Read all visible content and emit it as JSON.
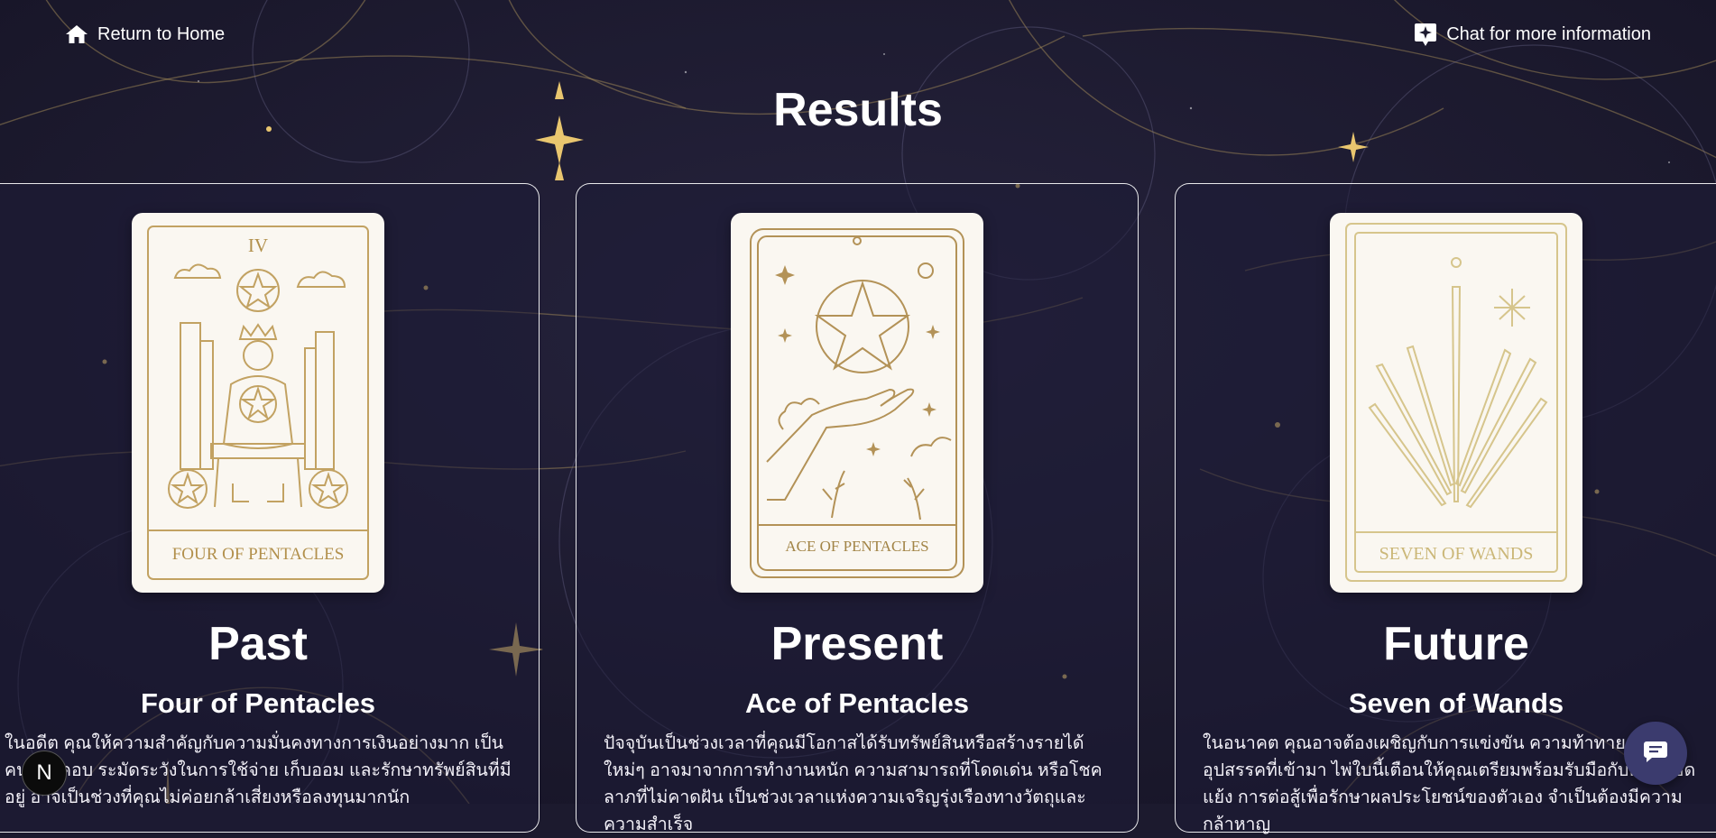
{
  "nav": {
    "home_label": "Return to Home",
    "chat_label": "Chat for more information"
  },
  "page": {
    "title": "Results"
  },
  "colors": {
    "background": "#1c1a2e",
    "gold": "#c9a95a",
    "card_face": "#faf7f1"
  },
  "cards": [
    {
      "slot": "Past",
      "name": "Four of Pentacles",
      "numeral": "IV",
      "face_title": "FOUR OF PENTACLES",
      "reading": "ในอดีต คุณให้ความสำคัญกับความมั่นคงทางการเงินอย่างมาก เป็นคนรอบคอบ ระมัดระวังในการใช้จ่าย เก็บออม และรักษาทรัพย์สินที่มีอยู่ อาจเป็นช่วงที่คุณไม่ค่อยกล้าเสี่ยงหรือลงทุนมากนัก"
    },
    {
      "slot": "Present",
      "name": "Ace of Pentacles",
      "face_title": "ACE OF PENTACLES",
      "reading": "ปัจจุบันเป็นช่วงเวลาที่คุณมีโอกาสได้รับทรัพย์สินหรือสร้างรายได้ใหม่ๆ อาจมาจากการทำงานหนัก ความสามารถที่โดดเด่น หรือโชคลาภที่ไม่คาดฝัน เป็นช่วงเวลาแห่งความเจริญรุ่งเรืองทางวัตถุและความสำเร็จ"
    },
    {
      "slot": "Future",
      "name": "Seven of Wands",
      "face_title": "SEVEN OF WANDS",
      "reading": "ในอนาคต คุณอาจต้องเผชิญกับการแข่งขัน ความท้าทาย หรืออุปสรรคที่เข้ามา ไพ่ใบนี้เตือนให้คุณเตรียมพร้อมรับมือกับความขัดแย้ง การต่อสู้เพื่อรักษาผลประโยชน์ของตัวเอง จำเป็นต้องมีความกล้าหาญ"
    }
  ],
  "badges": {
    "n_badge": "N"
  },
  "icons": {
    "home": "home-icon",
    "chat": "sparkle-chat-icon",
    "fab": "chat-bubble-icon"
  }
}
